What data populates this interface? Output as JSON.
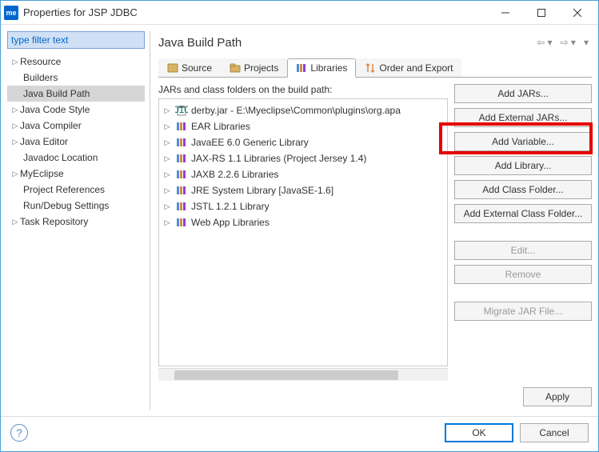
{
  "window": {
    "title": "Properties for JSP JDBC"
  },
  "filter": {
    "placeholder": "type filter text"
  },
  "tree": {
    "items": [
      {
        "label": "Resource",
        "expandable": true
      },
      {
        "label": "Builders"
      },
      {
        "label": "Java Build Path",
        "selected": true
      },
      {
        "label": "Java Code Style",
        "expandable": true
      },
      {
        "label": "Java Compiler",
        "expandable": true
      },
      {
        "label": "Java Editor",
        "expandable": true
      },
      {
        "label": "Javadoc Location"
      },
      {
        "label": "MyEclipse",
        "expandable": true
      },
      {
        "label": "Project References"
      },
      {
        "label": "Run/Debug Settings"
      },
      {
        "label": "Task Repository",
        "expandable": true
      }
    ]
  },
  "main": {
    "title": "Java Build Path",
    "tabs": [
      {
        "label": "Source"
      },
      {
        "label": "Projects"
      },
      {
        "label": "Libraries",
        "active": true
      },
      {
        "label": "Order and Export"
      }
    ],
    "jars_label": "JARs and class folders on the build path:",
    "jars": [
      {
        "label": "derby.jar - E:\\Myeclipse\\Common\\plugins\\org.apa",
        "type": "jar"
      },
      {
        "label": "EAR Libraries",
        "type": "lib"
      },
      {
        "label": "JavaEE 6.0 Generic Library",
        "type": "lib"
      },
      {
        "label": "JAX-RS 1.1 Libraries (Project Jersey 1.4)",
        "type": "lib"
      },
      {
        "label": "JAXB 2.2.6 Libraries",
        "type": "lib"
      },
      {
        "label": "JRE System Library [JavaSE-1.6]",
        "type": "lib"
      },
      {
        "label": "JSTL 1.2.1 Library",
        "type": "lib"
      },
      {
        "label": "Web App Libraries",
        "type": "lib"
      }
    ],
    "buttons": {
      "add_jars": "Add JARs...",
      "add_external_jars": "Add External JARs...",
      "add_variable": "Add Variable...",
      "add_library": "Add Library...",
      "add_class_folder": "Add Class Folder...",
      "add_external_class_folder": "Add External Class Folder...",
      "edit": "Edit...",
      "remove": "Remove",
      "migrate": "Migrate JAR File..."
    },
    "apply": "Apply"
  },
  "footer": {
    "ok": "OK",
    "cancel": "Cancel"
  }
}
